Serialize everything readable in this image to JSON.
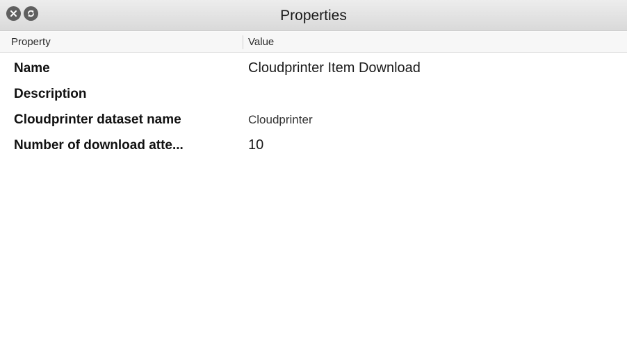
{
  "window": {
    "title": "Properties"
  },
  "columns": {
    "property": "Property",
    "value": "Value"
  },
  "rows": [
    {
      "property": "Name",
      "value": "Cloudprinter Item Download"
    },
    {
      "property": "Description",
      "value": ""
    },
    {
      "property": "Cloudprinter dataset name",
      "value": "Cloudprinter"
    },
    {
      "property": "Number of download atte...",
      "value": "10"
    }
  ],
  "icons": {
    "close": "close-icon",
    "restore": "restore-icon"
  }
}
